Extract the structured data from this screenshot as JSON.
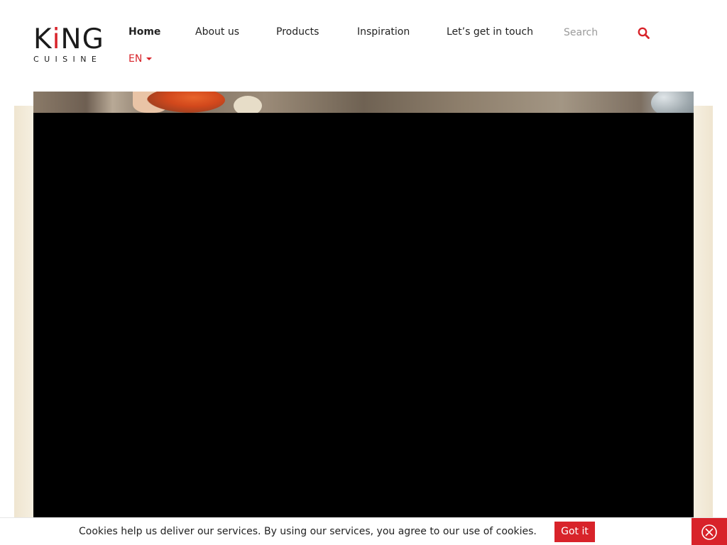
{
  "header": {
    "logo": {
      "word_part1": "K",
      "word_dot": "i",
      "word_part2": "NG",
      "sub": "CUISINE"
    },
    "nav": [
      {
        "label": "Home",
        "active": true
      },
      {
        "label": "About us",
        "active": false
      },
      {
        "label": "Products",
        "active": false
      },
      {
        "label": "Inspiration",
        "active": false
      },
      {
        "label": "Let’s get in touch",
        "active": false
      }
    ],
    "language": "EN",
    "search": {
      "placeholder": "Search",
      "icon": "search-icon"
    }
  },
  "cookie_bar": {
    "message": "Cookies help us deliver our services. By using our services, you agree to our use of cookies.",
    "accept_label": "Got it",
    "close_icon": "close-circle-icon"
  },
  "colors": {
    "accent": "#d8232a",
    "video_bg": "#000000",
    "panel_bg": "#f4ecdb"
  }
}
